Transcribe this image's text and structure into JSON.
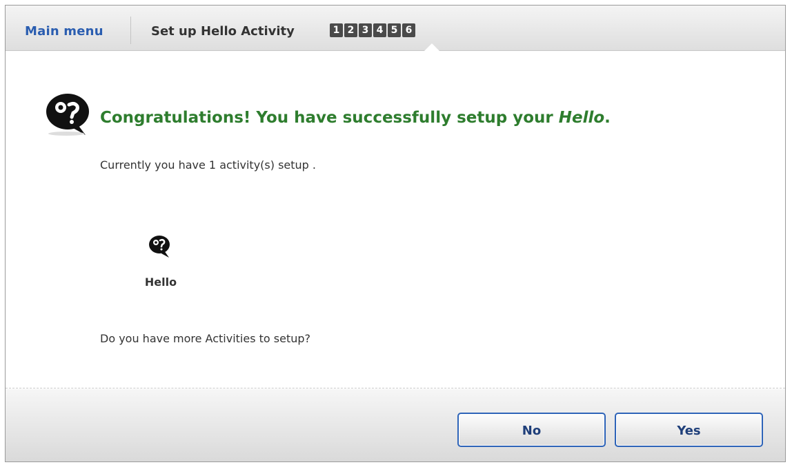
{
  "header": {
    "main_menu_label": "Main menu",
    "setup_title": "Set up Hello Activity",
    "steps": [
      "1",
      "2",
      "3",
      "4",
      "5",
      "6"
    ]
  },
  "content": {
    "congrats_prefix": "Congratulations! You have successfully setup your ",
    "congrats_product": "Hello",
    "congrats_suffix": ".",
    "currently_text": "Currently you have 1 activity(s) setup .",
    "activity": {
      "label": "Hello",
      "icon": "hello-logo-icon"
    },
    "question_text": "Do you have more Activities to setup?"
  },
  "footer": {
    "no_label": "No",
    "yes_label": "Yes"
  },
  "colors": {
    "link_blue": "#2a5db0",
    "success_green": "#2e7d2e",
    "button_border": "#2d63b8"
  }
}
